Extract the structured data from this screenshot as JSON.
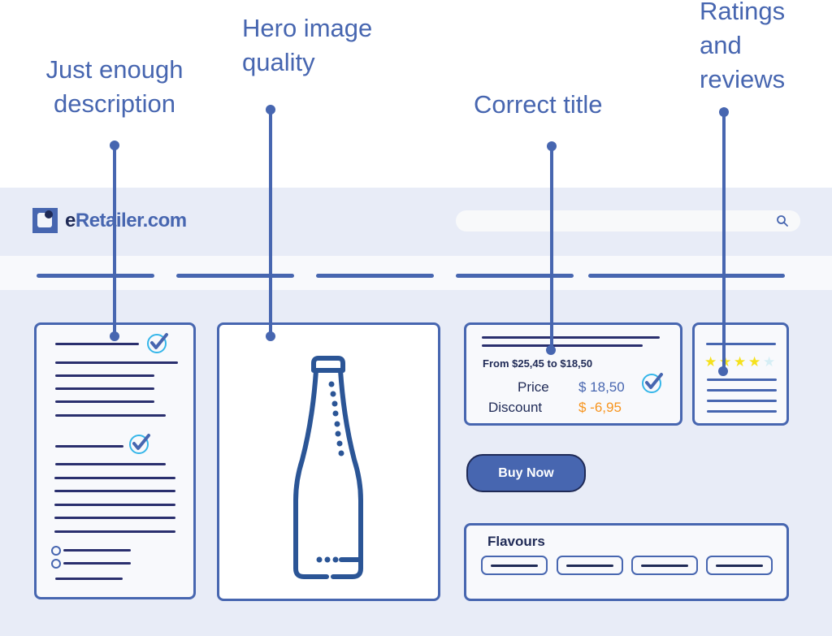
{
  "callouts": {
    "description": [
      "Just enough",
      "description"
    ],
    "hero_image": [
      "Hero image",
      "quality"
    ],
    "title": [
      "Correct title"
    ],
    "ratings": [
      "Ratings",
      "and",
      "reviews"
    ]
  },
  "header": {
    "logo_text_prefix": "e",
    "logo_text_rest": "Retailer.com",
    "search_placeholder": "",
    "search_icon": "search-icon"
  },
  "nav": {
    "item_count": 5
  },
  "price_card": {
    "range_text": "From $25,45 to $18,50",
    "price_label": "Price",
    "price_value": "$ 18,50",
    "discount_label": "Discount",
    "discount_value": "$ -6,95",
    "price_color": "#4766b0",
    "discount_color": "#f7941d"
  },
  "ratings_card": {
    "rating": 4,
    "max_rating": 5
  },
  "buy_button": {
    "label": "Buy Now"
  },
  "flavours": {
    "title": "Flavours",
    "option_count": 4
  },
  "colors": {
    "brand": "#4766b0",
    "dark_navy": "#1f2a56",
    "background": "#e8ecf7",
    "check_ring": "#35b6e9",
    "star_filled": "#f5e11c",
    "star_empty": "#d6eef5"
  }
}
